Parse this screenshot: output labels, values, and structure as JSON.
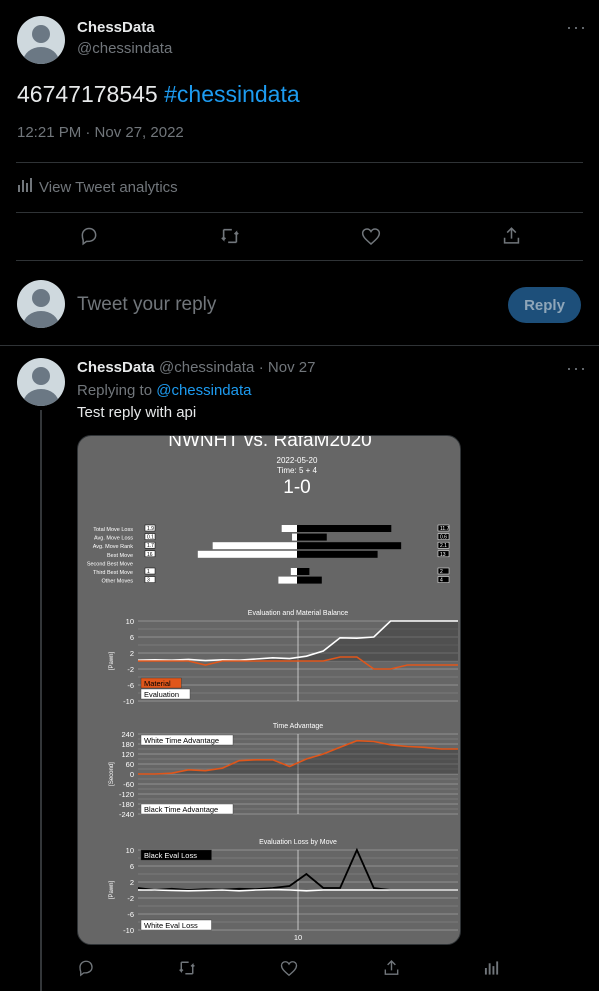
{
  "tweet": {
    "author_name": "ChessData",
    "author_handle": "@chessindata",
    "text_number": "46747178545",
    "text_hashtag": "#chessindata",
    "timestamp": "12:21 PM · Nov 27, 2022",
    "analytics_label": "View Tweet analytics"
  },
  "compose": {
    "placeholder": "Tweet your reply",
    "button_label": "Reply"
  },
  "reply": {
    "author_name": "ChessData",
    "author_handle": "@chessindata",
    "date": "· Nov 27",
    "replying_prefix": "Replying to",
    "replying_handle": "@chessindata",
    "text": "Test reply with api"
  },
  "colors": {
    "accent": "#1d9bf0",
    "orange": "#e0561a",
    "chart_bg": "#666666"
  },
  "chart_card": {
    "title": "NWNHT vs. RafaM2020",
    "date": "2022-05-20",
    "time_control": "Time: 5 + 4",
    "result": "1-0",
    "stat_rows": [
      {
        "label": "Total Move Loss",
        "white": "1.9",
        "black": "11.7"
      },
      {
        "label": "Avg. Move Loss",
        "white": "0.1",
        "black": "0.6"
      },
      {
        "label": "Avg. Move Rank",
        "white": "1.7",
        "black": "2.1"
      },
      {
        "label": "Best Move",
        "white": "16",
        "black": "13"
      },
      {
        "label": "Second Best Move",
        "white": "",
        "black": ""
      },
      {
        "label": "Third Best Move",
        "white": "1",
        "black": "2"
      },
      {
        "label": "Other Moves",
        "white": "3",
        "black": "4"
      }
    ]
  },
  "chart_data": [
    {
      "type": "bar",
      "title": "",
      "categories": [
        "Total Move Loss",
        "Avg. Move Loss",
        "Avg. Move Rank",
        "Best Move",
        "Second Best Move",
        "Third Best Move",
        "Other Moves"
      ],
      "series": [
        {
          "name": "White",
          "values": [
            1.9,
            0.1,
            1.7,
            16,
            0,
            1,
            3
          ]
        },
        {
          "name": "Black",
          "values": [
            11.7,
            0.6,
            2.1,
            13,
            0,
            2,
            4
          ]
        }
      ]
    },
    {
      "type": "line",
      "title": "Evaluation and Material Balance",
      "ylabel": "[Pawn]",
      "ylim": [
        -10,
        10
      ],
      "yticks": [
        10,
        6,
        2,
        -2,
        -6,
        -10
      ],
      "x": [
        1,
        2,
        3,
        4,
        5,
        6,
        7,
        8,
        9,
        10,
        11,
        12,
        13,
        14,
        15,
        16,
        17,
        18,
        19,
        20
      ],
      "series": [
        {
          "name": "Evaluation",
          "values": [
            0.2,
            0.3,
            0.2,
            0.4,
            0.1,
            0.3,
            0.2,
            0.5,
            0.8,
            0.6,
            1.2,
            2.5,
            5.8,
            5.7,
            6.0,
            10,
            10,
            10,
            10,
            10
          ]
        },
        {
          "name": "Material",
          "values": [
            0,
            0,
            0,
            0,
            -1,
            0,
            0,
            0,
            0,
            0,
            0,
            0,
            1,
            1,
            -2,
            -2,
            -1,
            -1,
            -1,
            -1
          ]
        }
      ],
      "legend": [
        "Material",
        "Evaluation"
      ]
    },
    {
      "type": "line",
      "title": "Time Advantage",
      "ylabel": "[Second]",
      "ylim": [
        -240,
        240
      ],
      "yticks": [
        240,
        180,
        120,
        60,
        0,
        -60,
        -120,
        -180,
        -240
      ],
      "x": [
        1,
        2,
        3,
        4,
        5,
        6,
        7,
        8,
        9,
        10,
        11,
        12,
        13,
        14,
        15,
        16,
        17,
        18,
        19,
        20
      ],
      "series": [
        {
          "name": "Time",
          "values": [
            0,
            0,
            5,
            25,
            20,
            35,
            80,
            85,
            85,
            45,
            90,
            120,
            160,
            200,
            195,
            175,
            165,
            160,
            150,
            150
          ]
        }
      ],
      "legend": [
        "White Time Advantage",
        "Black Time Advantage"
      ]
    },
    {
      "type": "line",
      "title": "Evaluation Loss by Move",
      "ylabel": "[Pawn]",
      "ylim": [
        -10,
        10
      ],
      "yticks": [
        10,
        6,
        2,
        -2,
        -6,
        -10
      ],
      "xlabel_tick": "10",
      "x": [
        1,
        2,
        3,
        4,
        5,
        6,
        7,
        8,
        9,
        10,
        11,
        12,
        13,
        14,
        15,
        16,
        17,
        18,
        19,
        20
      ],
      "series": [
        {
          "name": "Black Eval Loss",
          "values": [
            0.5,
            0,
            0.3,
            0,
            0.2,
            0.1,
            0.3,
            0.2,
            0.5,
            1,
            4,
            0.5,
            0.5,
            10,
            0.5,
            0,
            0,
            0,
            0,
            0
          ]
        },
        {
          "name": "White Eval Loss",
          "values": [
            0,
            0,
            -0.1,
            -0.2,
            -0.1,
            0,
            -0.2,
            0,
            0.1,
            0,
            -0.2,
            0,
            0,
            0,
            0,
            0,
            0,
            0,
            0,
            0
          ]
        }
      ],
      "legend": [
        "Black Eval Loss",
        "White Eval Loss"
      ]
    }
  ]
}
